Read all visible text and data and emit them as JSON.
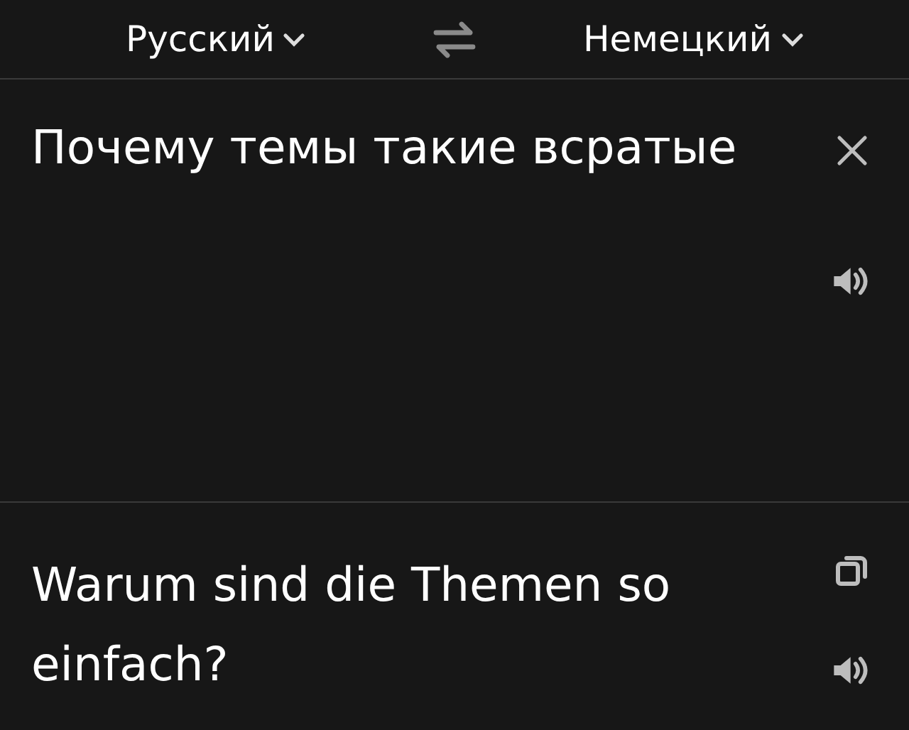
{
  "languages": {
    "source": "Русский",
    "target": "Немецкий"
  },
  "input": {
    "value": "Почему темы такие всратые"
  },
  "output": {
    "text": "Warum sind die Themen so einfach?"
  }
}
